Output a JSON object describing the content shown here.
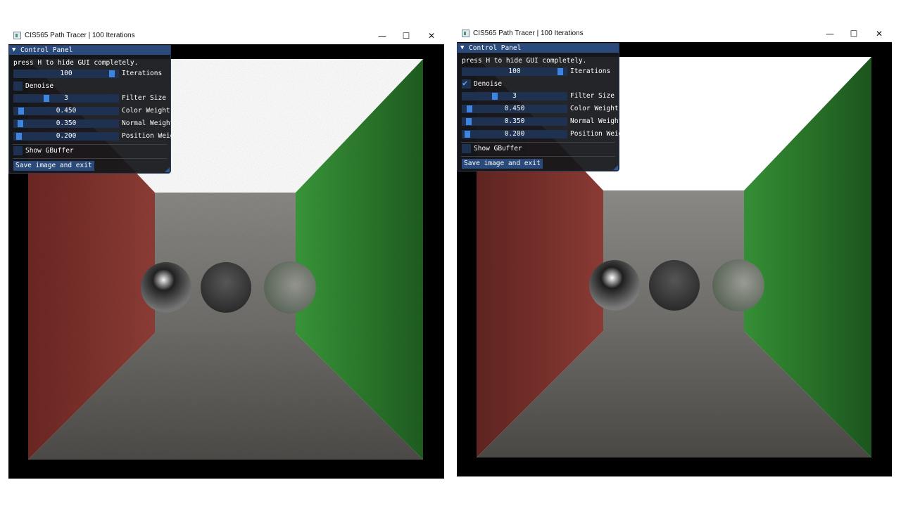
{
  "windows": [
    {
      "id": "left",
      "title": "CIS565 Path Tracer | 100 Iterations",
      "window_buttons": {
        "minimize": "—",
        "maximize": "☐",
        "close": "✕"
      },
      "panel": {
        "header": "Control Panel",
        "header_icon": "triangle-down-icon",
        "hint": "press H to hide GUI completely.",
        "sliders": [
          {
            "key": "iterations",
            "value": "100",
            "label": "Iterations",
            "fraction": 0.96
          },
          {
            "key": "filter_size",
            "value": "3",
            "label": "Filter Size",
            "fraction": 0.3
          },
          {
            "key": "color_weight",
            "value": "0.450",
            "label": "Color Weight",
            "fraction": 0.05
          },
          {
            "key": "normal_weight",
            "value": "0.350",
            "label": "Normal Weight",
            "fraction": 0.04
          },
          {
            "key": "position_weight",
            "value": "0.200",
            "label": "Position Weig",
            "fraction": 0.03
          }
        ],
        "denoise": {
          "label": "Denoise",
          "checked": false
        },
        "show_gbuffer": {
          "label": "Show GBuffer",
          "checked": false
        },
        "save_button": "Save image and exit"
      },
      "render": {
        "noisy": true
      }
    },
    {
      "id": "right",
      "title": "CIS565 Path Tracer | 100 Iterations",
      "window_buttons": {
        "minimize": "—",
        "maximize": "☐",
        "close": "✕"
      },
      "panel": {
        "header": "Control Panel",
        "header_icon": "triangle-down-icon",
        "hint": "press H to hide GUI completely.",
        "sliders": [
          {
            "key": "iterations",
            "value": "100",
            "label": "Iterations",
            "fraction": 0.96
          },
          {
            "key": "filter_size",
            "value": "3",
            "label": "Filter Size",
            "fraction": 0.3
          },
          {
            "key": "color_weight",
            "value": "0.450",
            "label": "Color Weight",
            "fraction": 0.05
          },
          {
            "key": "normal_weight",
            "value": "0.350",
            "label": "Normal Weight",
            "fraction": 0.04
          },
          {
            "key": "position_weight",
            "value": "0.200",
            "label": "Position Weig",
            "fraction": 0.03
          }
        ],
        "denoise": {
          "label": "Denoise",
          "checked": true,
          "mark": "✔"
        },
        "show_gbuffer": {
          "label": "Show GBuffer",
          "checked": false
        },
        "save_button": "Save image and exit"
      },
      "render": {
        "noisy": false
      }
    }
  ],
  "colors": {
    "panel_header": "#294a7a",
    "slider_bg": "#1e3150",
    "slider_grab": "#3d85e0",
    "check_mark": "#63a4ff",
    "left_wall": "#8a3a34",
    "right_wall": "#2f7a2f",
    "ceiling_light": "#ffffff"
  }
}
